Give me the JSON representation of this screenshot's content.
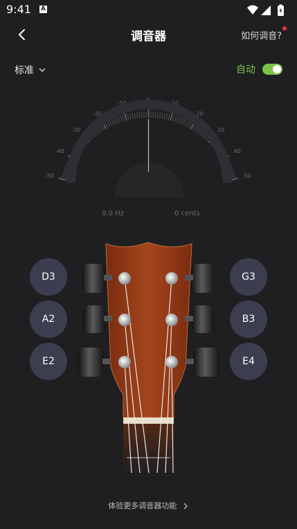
{
  "status_bar": {
    "time": "9:41",
    "notification": "A"
  },
  "header": {
    "title": "调音器",
    "help_label": "如何调音?"
  },
  "controls": {
    "tuning_label": "标准",
    "auto_label": "自动",
    "auto_enabled": true
  },
  "gauge": {
    "scale_labels": [
      "-50",
      "-40",
      "-30",
      "-20",
      "-10",
      "0",
      "10",
      "20",
      "30",
      "40",
      "50"
    ],
    "frequency": "0.0 Hz",
    "cents": "0 cents"
  },
  "strings": {
    "left": [
      "D3",
      "A2",
      "E2"
    ],
    "right": [
      "G3",
      "B3",
      "E4"
    ]
  },
  "footer": {
    "more_label": "体验更多调音器功能"
  },
  "colors": {
    "background": "#1f1f21",
    "accent_green": "#7bc34a",
    "button_bg": "#3c3e4f",
    "help_dot": "#e53935"
  }
}
